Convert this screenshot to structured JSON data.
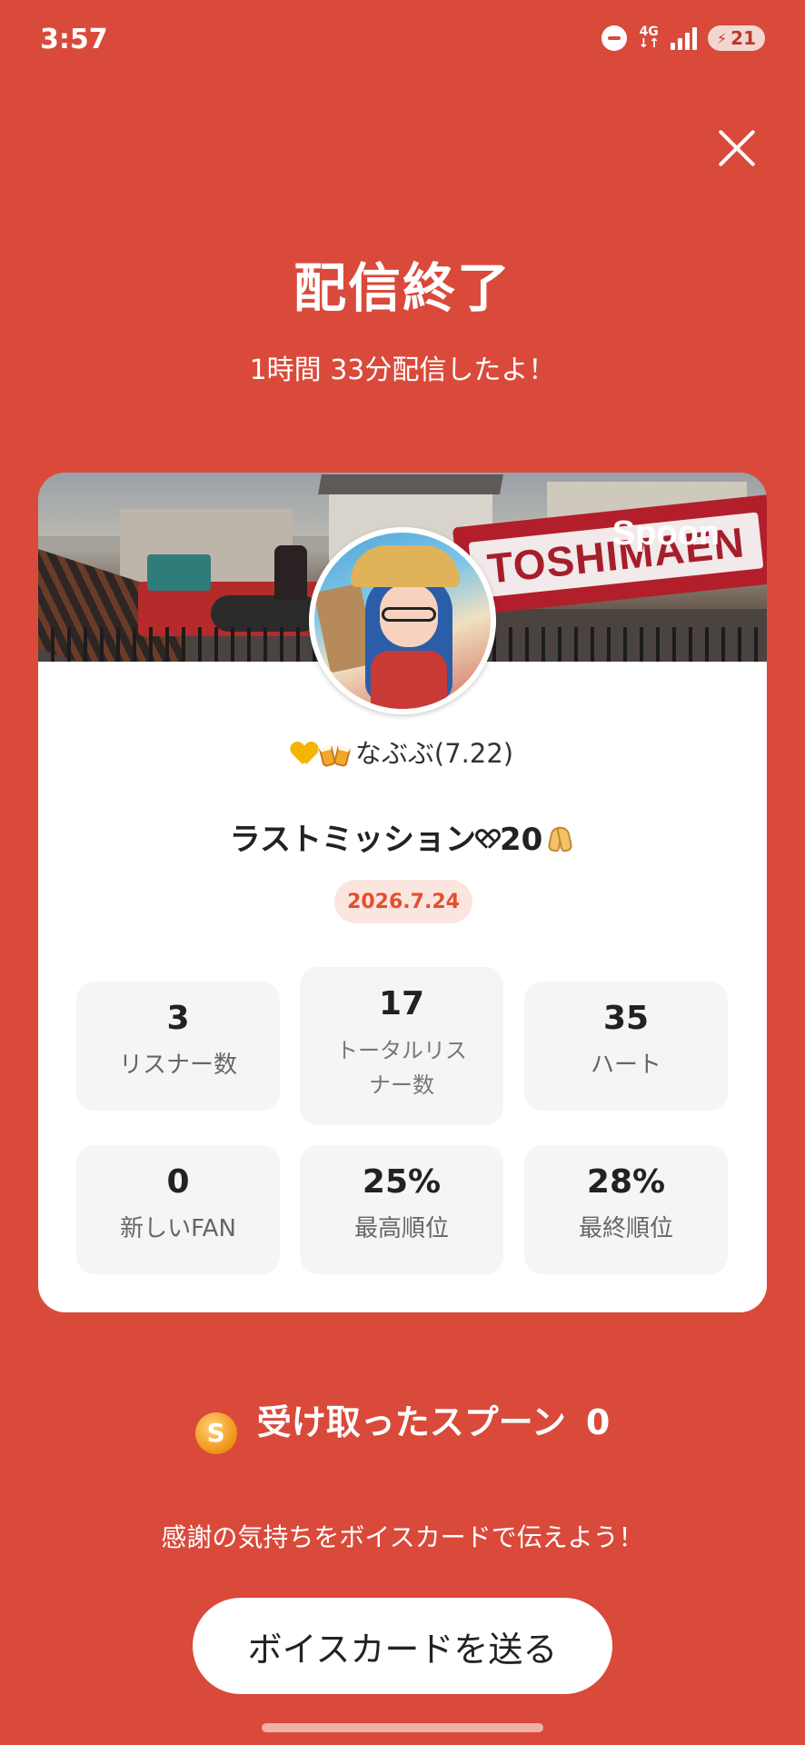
{
  "status_bar": {
    "time": "3:57",
    "network": "4G",
    "battery": "21"
  },
  "header": {
    "title": "配信終了",
    "duration": "1時間 33分配信したよ！"
  },
  "card": {
    "cover_sign": "TOSHIMAEN",
    "logo": "Spoon",
    "nickname": "なぶぶ(7.22)",
    "broadcast_title_before": "ラストミッション",
    "broadcast_title_after": "20",
    "date": "2026.7.24",
    "stats": [
      {
        "value": "3",
        "label": "リスナー数"
      },
      {
        "value": "17",
        "label_line1": "トータルリス",
        "label_line2": "ナー数"
      },
      {
        "value": "35",
        "label": "ハート"
      },
      {
        "value": "0",
        "label": "新しいFAN"
      },
      {
        "value": "25%",
        "label": "最高順位"
      },
      {
        "value": "28%",
        "label": "最終順位"
      }
    ]
  },
  "spoons": {
    "icon_letter": "S",
    "label": "受け取ったスプーン",
    "count": "0"
  },
  "thanks": {
    "text": "感謝の気持ちをボイスカードで伝えよう！"
  },
  "button": {
    "label": "ボイスカードを送る"
  },
  "colors": {
    "background": "#d94a3b",
    "date_badge_bg": "#fbe5df",
    "date_badge_text": "#e2502f",
    "coin": "#f29b1f"
  }
}
